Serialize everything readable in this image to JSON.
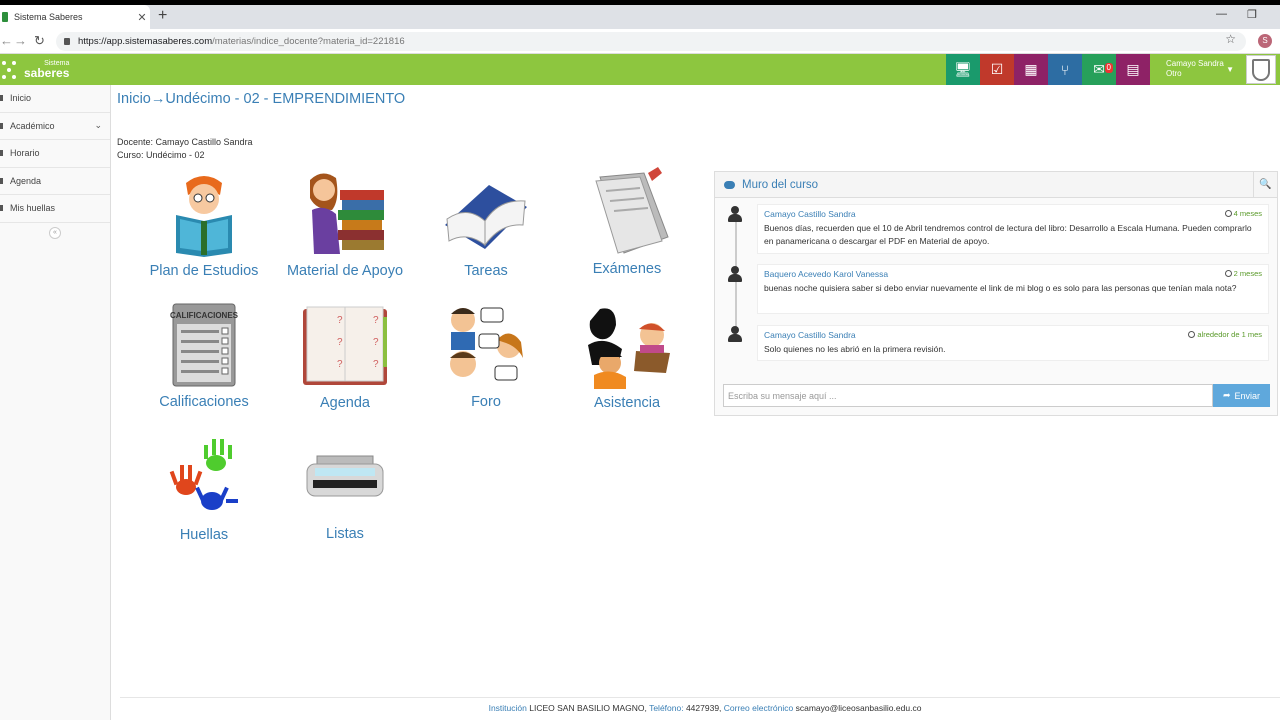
{
  "browser": {
    "tab_title": "Sistema Saberes",
    "tab_close": "✕",
    "new_tab": "+",
    "url_host": "https://app.sistemasaberes.com",
    "url_path": "/materias/indice_docente?materia_id=221816",
    "profile_initial": "S"
  },
  "header": {
    "logo_small": "Sistema",
    "logo_big": "saberes",
    "icons": [
      {
        "name": "monitor-icon",
        "color": "#1a9a6c",
        "glyph": "🖥"
      },
      {
        "name": "checklist-icon",
        "color": "#c0392b",
        "glyph": "☑"
      },
      {
        "name": "calendar-icon",
        "color": "#8e2266",
        "glyph": "▦"
      },
      {
        "name": "branch-icon",
        "color": "#2d6da3",
        "glyph": "⑂"
      },
      {
        "name": "mail-icon",
        "color": "#27a05a",
        "glyph": "✉",
        "badge": "0"
      },
      {
        "name": "book-icon",
        "color": "#8e2266",
        "glyph": "▤"
      }
    ],
    "user_name": "Camayo Sandra",
    "user_role": "Otro"
  },
  "sidebar": {
    "items": [
      {
        "label": "Inicio"
      },
      {
        "label": "Académico"
      },
      {
        "label": "Horario"
      },
      {
        "label": "Agenda"
      },
      {
        "label": "Mis huellas"
      }
    ],
    "collapse": "«"
  },
  "main": {
    "breadcrumb": "Inicio→Undécimo - 02 - EMPRENDIMIENTO",
    "docente": "Docente: Camayo Castillo Sandra",
    "curso": "Curso: Undécimo - 02",
    "tiles": [
      {
        "label": "Plan de Estudios"
      },
      {
        "label": "Material de Apoyo"
      },
      {
        "label": "Tareas"
      },
      {
        "label": "Exámenes"
      },
      {
        "label": "Calificaciones"
      },
      {
        "label": "Agenda"
      },
      {
        "label": "Foro"
      },
      {
        "label": "Asistencia"
      },
      {
        "label": "Huellas"
      },
      {
        "label": "Listas"
      }
    ],
    "calificaciones_sign": "CALIFICACIONES"
  },
  "muro": {
    "title": "Muro del curso",
    "messages": [
      {
        "author": "Camayo Castillo Sandra",
        "time": "4 meses",
        "text": "Buenos días, recuerden que el 10 de Abril tendremos control de lectura del libro: Desarrollo a Escala Humana. Pueden comprarlo en panamericana o descargar el PDF en Material de apoyo."
      },
      {
        "author": "Baquero Acevedo Karol Vanessa",
        "time": "2 meses",
        "text": "buenas noche quisiera saber si debo enviar nuevamente el link de mi blog o es solo para las personas que tenían mala nota?"
      },
      {
        "author": "Camayo Castillo Sandra",
        "time": "alrededor de 1 mes",
        "text": "Solo quienes no les abrió en la primera revisión."
      }
    ],
    "input_placeholder": "Escriba su mensaje aquí ...",
    "send_label": "Enviar"
  },
  "footer": {
    "inst_label": "Institución",
    "inst_value": "LICEO SAN BASILIO MAGNO,",
    "tel_label": "Teléfono:",
    "tel_value": "4427939,",
    "mail_label": "Correo electrónico",
    "mail_value": "scamayo@liceosanbasilio.edu.co"
  }
}
